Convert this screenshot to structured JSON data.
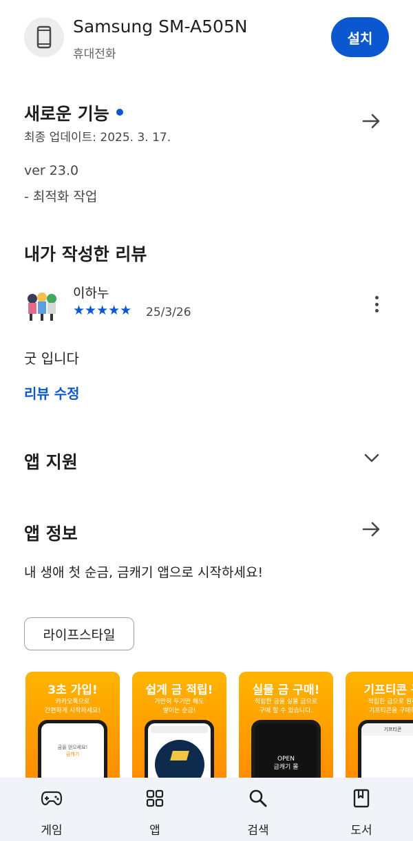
{
  "device": {
    "name": "Samsung SM-A505N",
    "type": "휴대전화",
    "install_label": "설치",
    "icon": "phone-icon"
  },
  "whats_new": {
    "title": "새로운 기능",
    "updated": "최종 업데이트: 2025. 3. 17.",
    "notes": [
      "ver 23.0",
      "- 최적화 작업"
    ]
  },
  "my_review": {
    "title": "내가 작성한 리뷰",
    "reviewer": "이하누",
    "rating": 5,
    "stars": "★★★★★",
    "date": "25/3/26",
    "text": "굿 입니다",
    "edit_label": "리뷰 수정"
  },
  "app_support": {
    "title": "앱 지원"
  },
  "app_info": {
    "title": "앱 정보",
    "description": "내 생애 첫 순금, 금캐기 앱으로 시작하세요!",
    "category_chip": "라이프스타일"
  },
  "screenshots": [
    {
      "title": "3초 가입!",
      "sub1": "카카오톡으로",
      "sub2": "간편하게 시작하세요!",
      "screen1": "금을 얻으세요!",
      "screen2": "금캐기"
    },
    {
      "title": "쉽게 금 적립!",
      "sub1": "가만히 두기만 해도",
      "sub2": "쌓이는 순금!"
    },
    {
      "title": "실물 금 구매!",
      "sub1": "적립한 금을 실물 금으로",
      "sub2": "구매 할 수 있습니다.",
      "screen1": "OPEN",
      "screen2": "금캐기 몰"
    },
    {
      "title": "기프티콘 구",
      "sub1": "적립한 금으로 원하",
      "sub2": "기프티콘을 구매하",
      "screen1": "기프티콘"
    }
  ],
  "bottom_nav": [
    {
      "label": "게임",
      "icon": "gamepad-icon"
    },
    {
      "label": "앱",
      "icon": "apps-grid-icon"
    },
    {
      "label": "검색",
      "icon": "search-icon"
    },
    {
      "label": "도서",
      "icon": "book-icon"
    }
  ],
  "colors": {
    "accent": "#0b57d0",
    "nav_background": "#f0f4f9",
    "screenshot_gradient_top": "#ffb400",
    "screenshot_gradient_bottom": "#ff8a00"
  }
}
